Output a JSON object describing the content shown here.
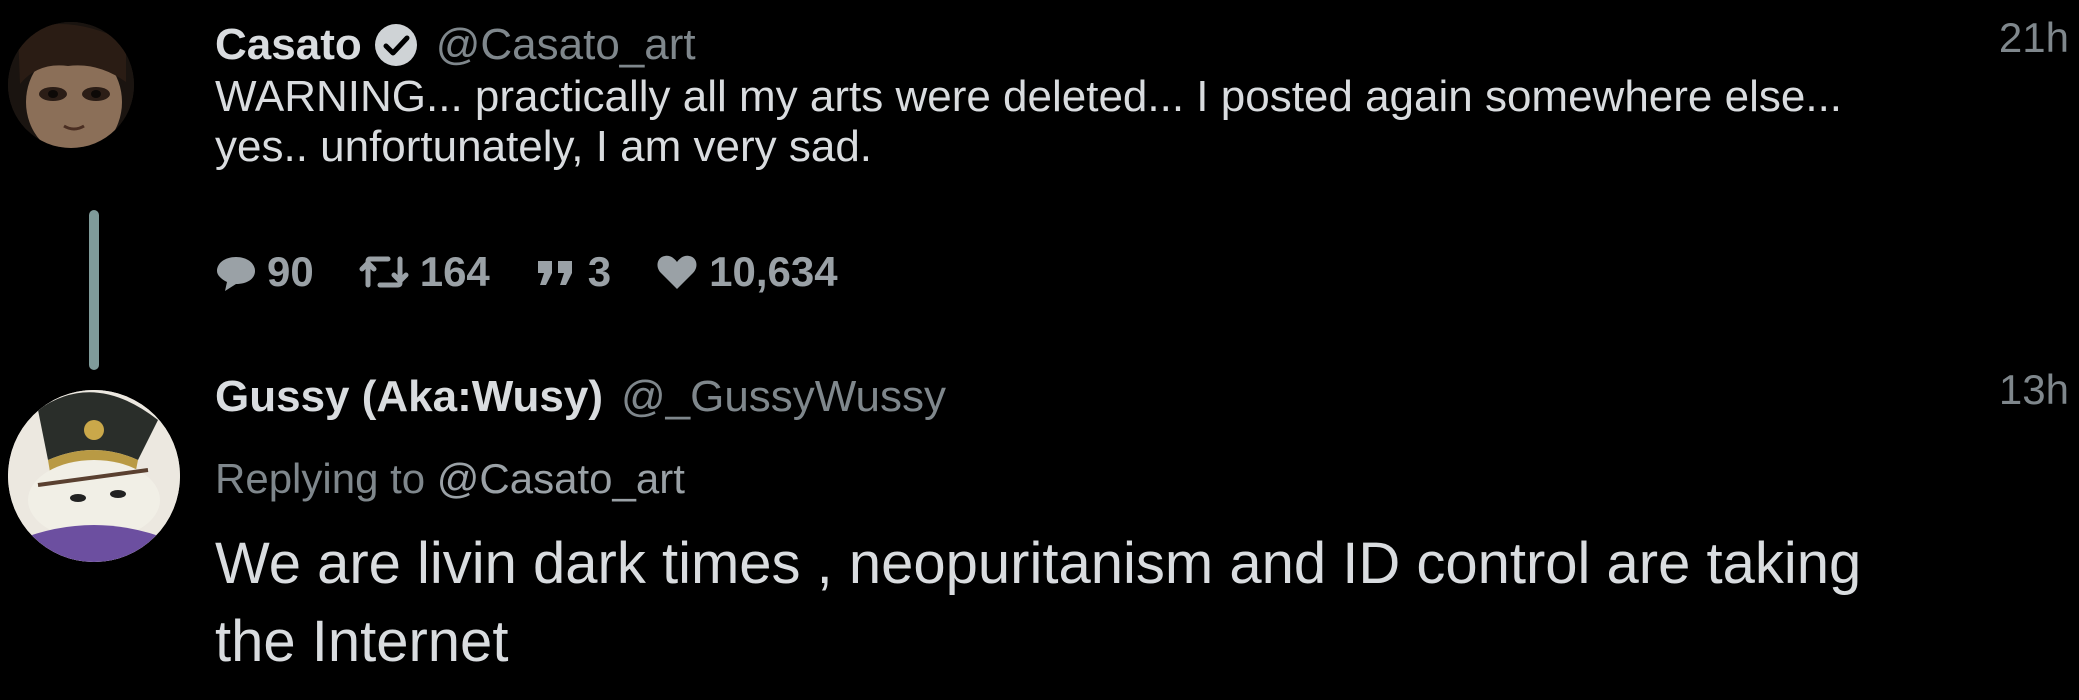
{
  "tweet1": {
    "display_name": "Casato",
    "verified": true,
    "handle": "@Casato_art",
    "time": "21h",
    "text_line1": "WARNING... practically all my arts were deleted... I posted again somewhere else...",
    "text_line2": "yes.. unfortunately, I am very sad.",
    "stats": {
      "replies": "90",
      "retweets": "164",
      "quotes": "3",
      "likes": "10,634"
    }
  },
  "tweet2": {
    "display_name": "Gussy (Aka:Wusy)",
    "handle": "@_GussyWussy",
    "time": "13h",
    "replying_to_prefix": "Replying to",
    "replying_to_handle": "@Casato_art",
    "text_line1": "We are livin dark times , neopuritanism and ID control are taking",
    "text_line2": "the Internet"
  },
  "colors": {
    "background": "#000000",
    "primary_text": "#d9dcdf",
    "secondary_text": "#7f878c",
    "thread_line": "#7f9b9a"
  },
  "icons": [
    "reply-icon",
    "retweet-icon",
    "quote-icon",
    "like-icon",
    "verified-badge-icon"
  ]
}
